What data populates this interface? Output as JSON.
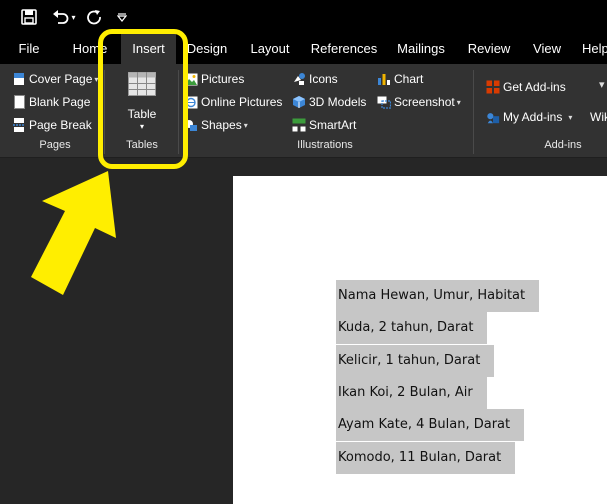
{
  "quick_access": {
    "items": [
      "save-icon",
      "undo-icon",
      "redo-icon",
      "customize-icon"
    ]
  },
  "tabs": [
    {
      "label": "File",
      "active": false
    },
    {
      "label": "Home",
      "active": false
    },
    {
      "label": "Insert",
      "active": true
    },
    {
      "label": "Design",
      "active": false
    },
    {
      "label": "Layout",
      "active": false
    },
    {
      "label": "References",
      "active": false
    },
    {
      "label": "Mailings",
      "active": false
    },
    {
      "label": "Review",
      "active": false
    },
    {
      "label": "View",
      "active": false
    },
    {
      "label": "Help",
      "active": false
    }
  ],
  "ribbon": {
    "pages": {
      "group_label": "Pages",
      "cover_page": "Cover Page",
      "blank_page": "Blank Page",
      "page_break": "Page Break"
    },
    "tables": {
      "group_label": "Tables",
      "table": "Table"
    },
    "illustrations": {
      "group_label": "Illustrations",
      "pictures": "Pictures",
      "online_pictures": "Online Pictures",
      "shapes": "Shapes",
      "icons": "Icons",
      "models_3d": "3D Models",
      "smartart": "SmartArt",
      "chart": "Chart",
      "screenshot": "Screenshot"
    },
    "addins": {
      "group_label": "Add-ins",
      "get_addins": "Get Add-ins",
      "my_addins": "My Add-ins",
      "wiki": "Wiki"
    }
  },
  "document": {
    "lines": [
      "Nama Hewan, Umur, Habitat",
      "Kuda, 2 tahun, Darat",
      "Kelicir, 1 tahun, Darat",
      "Ikan Koi, 2 Bulan, Air",
      "Ayam Kate, 4 Bulan, Darat",
      "Komodo, 11 Bulan, Darat"
    ]
  },
  "colors": {
    "highlight": "#ffee00",
    "selection": "#c6c6c6",
    "ribbon": "#323232",
    "titlebar": "#000000"
  }
}
